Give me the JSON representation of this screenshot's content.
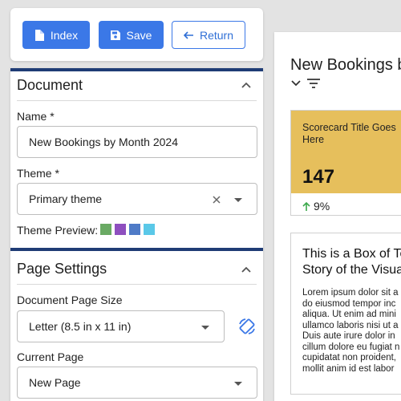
{
  "toolbar": {
    "index_label": "Index",
    "save_label": "Save",
    "return_label": "Return"
  },
  "document_section": {
    "title": "Document",
    "name_label": "Name *",
    "name_value": "New Bookings by Month 2024",
    "theme_label": "Theme *",
    "theme_value": "Primary theme",
    "theme_preview_label": "Theme Preview:",
    "theme_preview_colors": [
      "#6aaa64",
      "#8e4fbf",
      "#4f7bc7",
      "#5ac8e8"
    ]
  },
  "page_settings": {
    "title": "Page Settings",
    "page_size_label": "Document Page Size",
    "page_size_value": "Letter (8.5 in x 11 in)",
    "current_page_label": "Current Page",
    "current_page_value": "New Page"
  },
  "preview": {
    "title": "New Bookings b",
    "scorecard": {
      "title": "Scorecard Title Goes Here",
      "value": "147",
      "delta": "9%",
      "color": "#e6bf5c",
      "delta_color": "#3aa84a"
    },
    "textbox": {
      "heading": "This is a Box of Te\nStory of the Visua",
      "body": "Lorem ipsum dolor sit a\ndo eiusmod tempor inc\naliqua. Ut enim ad mini\nullamco laboris nisi ut a\nDuis aute irure dolor in\ncillum dolore eu fugiat n\ncupidatat non proident,\nmollit anim id est labor"
    }
  },
  "colors": {
    "primary": "#3b78e7",
    "section_bar": "#1f3c75"
  }
}
